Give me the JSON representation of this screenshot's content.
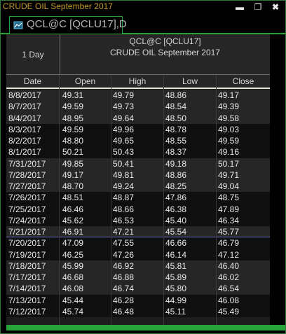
{
  "window": {
    "title": "CRUDE OIL September 2017",
    "minimize_icon": "minimize-icon",
    "restore_icon": "restore-icon",
    "close_icon": "close-icon"
  },
  "tab": {
    "label": "QCL@C [QCLU17],D",
    "icon": "chart-icon"
  },
  "header": {
    "period": "1 Day",
    "symbol": "QCL@C [QCLU17]",
    "name": "CRUDE OIL September 2017"
  },
  "columns": [
    "Date",
    "Open",
    "High",
    "Low",
    "Close"
  ],
  "rows": [
    {
      "date": "8/8/2017",
      "open": "49.31",
      "high": "49.79",
      "low": "48.86",
      "close": "49.17"
    },
    {
      "date": "8/7/2017",
      "open": "49.59",
      "high": "49.73",
      "low": "48.54",
      "close": "49.39"
    },
    {
      "date": "8/4/2017",
      "open": "48.95",
      "high": "49.64",
      "low": "48.50",
      "close": "49.58"
    },
    {
      "date": "8/3/2017",
      "open": "49.59",
      "high": "49.96",
      "low": "48.78",
      "close": "49.03"
    },
    {
      "date": "8/2/2017",
      "open": "48.80",
      "high": "49.65",
      "low": "48.55",
      "close": "49.59"
    },
    {
      "date": "8/1/2017",
      "open": "50.21",
      "high": "50.43",
      "low": "48.37",
      "close": "49.16"
    },
    {
      "date": "7/31/2017",
      "open": "49.85",
      "high": "50.41",
      "low": "49.18",
      "close": "50.17"
    },
    {
      "date": "7/28/2017",
      "open": "49.17",
      "high": "49.81",
      "low": "48.86",
      "close": "49.71"
    },
    {
      "date": "7/27/2017",
      "open": "48.70",
      "high": "49.24",
      "low": "48.25",
      "close": "49.04"
    },
    {
      "date": "7/26/2017",
      "open": "48.51",
      "high": "48.87",
      "low": "47.86",
      "close": "48.75"
    },
    {
      "date": "7/25/2017",
      "open": "46.46",
      "high": "48.66",
      "low": "46.38",
      "close": "47.89"
    },
    {
      "date": "7/24/2017",
      "open": "45.62",
      "high": "46.53",
      "low": "45.40",
      "close": "46.34"
    },
    {
      "date": "7/21/2017",
      "open": "46.91",
      "high": "47.21",
      "low": "45.54",
      "close": "45.77"
    },
    {
      "date": "7/20/2017",
      "open": "47.09",
      "high": "47.55",
      "low": "46.66",
      "close": "46.79"
    },
    {
      "date": "7/19/2017",
      "open": "46.25",
      "high": "47.26",
      "low": "46.14",
      "close": "47.12"
    },
    {
      "date": "7/18/2017",
      "open": "45.99",
      "high": "46.92",
      "low": "45.81",
      "close": "46.40"
    },
    {
      "date": "7/17/2017",
      "open": "46.68",
      "high": "46.88",
      "low": "45.89",
      "close": "46.02"
    },
    {
      "date": "7/14/2017",
      "open": "46.08",
      "high": "46.74",
      "low": "45.80",
      "close": "46.54"
    },
    {
      "date": "7/13/2017",
      "open": "45.44",
      "high": "46.28",
      "low": "44.99",
      "close": "46.08"
    },
    {
      "date": "7/12/2017",
      "open": "45.74",
      "high": "46.48",
      "low": "45.11",
      "close": "45.49"
    }
  ],
  "colors": {
    "title": "#c59a2b",
    "accent_green": "#27a33a",
    "highlight_line": "#6c6cd8"
  }
}
